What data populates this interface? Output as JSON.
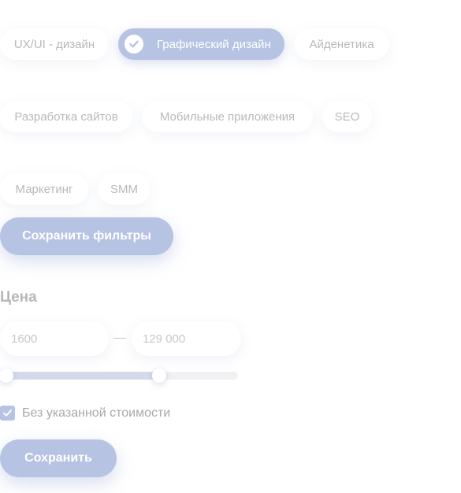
{
  "categories": [
    {
      "label": "UX/UI - дизайн",
      "active": false
    },
    {
      "label": "Графический дизайн",
      "active": true
    },
    {
      "label": "Айденетика",
      "active": false
    },
    {
      "label": "Разработка сайтов",
      "active": false
    },
    {
      "label": "Мобильные приложения",
      "active": false
    },
    {
      "label": "SEO",
      "active": false
    },
    {
      "label": "Маркетинг",
      "active": false
    },
    {
      "label": "SMM",
      "active": false
    }
  ],
  "save_filters_label": "Сохранить фильтры",
  "price": {
    "title": "Цена",
    "min_placeholder": "1600",
    "max_placeholder": "129 000",
    "range_fill_fraction": [
      0.0,
      0.68
    ]
  },
  "no_price_checkbox": {
    "label": "Без указанной стоимости",
    "checked": true
  },
  "save_label": "Сохранить",
  "colors": {
    "accent": "#b6c3e3",
    "text_muted": "#b9b9b9"
  },
  "icons": {
    "active_chip": "check-icon",
    "checkbox": "checkmark-icon"
  }
}
